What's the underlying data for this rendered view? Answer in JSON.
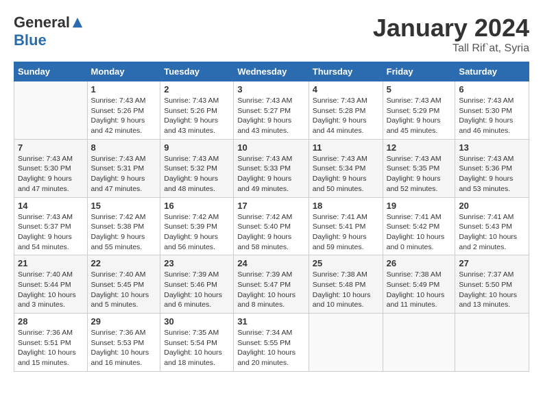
{
  "logo": {
    "general": "General",
    "blue": "Blue"
  },
  "title": "January 2024",
  "subtitle": "Tall Rif`at, Syria",
  "headers": [
    "Sunday",
    "Monday",
    "Tuesday",
    "Wednesday",
    "Thursday",
    "Friday",
    "Saturday"
  ],
  "weeks": [
    [
      {
        "day": "",
        "info": ""
      },
      {
        "day": "1",
        "info": "Sunrise: 7:43 AM\nSunset: 5:26 PM\nDaylight: 9 hours\nand 42 minutes."
      },
      {
        "day": "2",
        "info": "Sunrise: 7:43 AM\nSunset: 5:26 PM\nDaylight: 9 hours\nand 43 minutes."
      },
      {
        "day": "3",
        "info": "Sunrise: 7:43 AM\nSunset: 5:27 PM\nDaylight: 9 hours\nand 43 minutes."
      },
      {
        "day": "4",
        "info": "Sunrise: 7:43 AM\nSunset: 5:28 PM\nDaylight: 9 hours\nand 44 minutes."
      },
      {
        "day": "5",
        "info": "Sunrise: 7:43 AM\nSunset: 5:29 PM\nDaylight: 9 hours\nand 45 minutes."
      },
      {
        "day": "6",
        "info": "Sunrise: 7:43 AM\nSunset: 5:30 PM\nDaylight: 9 hours\nand 46 minutes."
      }
    ],
    [
      {
        "day": "7",
        "info": "Sunrise: 7:43 AM\nSunset: 5:30 PM\nDaylight: 9 hours\nand 47 minutes."
      },
      {
        "day": "8",
        "info": "Sunrise: 7:43 AM\nSunset: 5:31 PM\nDaylight: 9 hours\nand 47 minutes."
      },
      {
        "day": "9",
        "info": "Sunrise: 7:43 AM\nSunset: 5:32 PM\nDaylight: 9 hours\nand 48 minutes."
      },
      {
        "day": "10",
        "info": "Sunrise: 7:43 AM\nSunset: 5:33 PM\nDaylight: 9 hours\nand 49 minutes."
      },
      {
        "day": "11",
        "info": "Sunrise: 7:43 AM\nSunset: 5:34 PM\nDaylight: 9 hours\nand 50 minutes."
      },
      {
        "day": "12",
        "info": "Sunrise: 7:43 AM\nSunset: 5:35 PM\nDaylight: 9 hours\nand 52 minutes."
      },
      {
        "day": "13",
        "info": "Sunrise: 7:43 AM\nSunset: 5:36 PM\nDaylight: 9 hours\nand 53 minutes."
      }
    ],
    [
      {
        "day": "14",
        "info": "Sunrise: 7:43 AM\nSunset: 5:37 PM\nDaylight: 9 hours\nand 54 minutes."
      },
      {
        "day": "15",
        "info": "Sunrise: 7:42 AM\nSunset: 5:38 PM\nDaylight: 9 hours\nand 55 minutes."
      },
      {
        "day": "16",
        "info": "Sunrise: 7:42 AM\nSunset: 5:39 PM\nDaylight: 9 hours\nand 56 minutes."
      },
      {
        "day": "17",
        "info": "Sunrise: 7:42 AM\nSunset: 5:40 PM\nDaylight: 9 hours\nand 58 minutes."
      },
      {
        "day": "18",
        "info": "Sunrise: 7:41 AM\nSunset: 5:41 PM\nDaylight: 9 hours\nand 59 minutes."
      },
      {
        "day": "19",
        "info": "Sunrise: 7:41 AM\nSunset: 5:42 PM\nDaylight: 10 hours\nand 0 minutes."
      },
      {
        "day": "20",
        "info": "Sunrise: 7:41 AM\nSunset: 5:43 PM\nDaylight: 10 hours\nand 2 minutes."
      }
    ],
    [
      {
        "day": "21",
        "info": "Sunrise: 7:40 AM\nSunset: 5:44 PM\nDaylight: 10 hours\nand 3 minutes."
      },
      {
        "day": "22",
        "info": "Sunrise: 7:40 AM\nSunset: 5:45 PM\nDaylight: 10 hours\nand 5 minutes."
      },
      {
        "day": "23",
        "info": "Sunrise: 7:39 AM\nSunset: 5:46 PM\nDaylight: 10 hours\nand 6 minutes."
      },
      {
        "day": "24",
        "info": "Sunrise: 7:39 AM\nSunset: 5:47 PM\nDaylight: 10 hours\nand 8 minutes."
      },
      {
        "day": "25",
        "info": "Sunrise: 7:38 AM\nSunset: 5:48 PM\nDaylight: 10 hours\nand 10 minutes."
      },
      {
        "day": "26",
        "info": "Sunrise: 7:38 AM\nSunset: 5:49 PM\nDaylight: 10 hours\nand 11 minutes."
      },
      {
        "day": "27",
        "info": "Sunrise: 7:37 AM\nSunset: 5:50 PM\nDaylight: 10 hours\nand 13 minutes."
      }
    ],
    [
      {
        "day": "28",
        "info": "Sunrise: 7:36 AM\nSunset: 5:51 PM\nDaylight: 10 hours\nand 15 minutes."
      },
      {
        "day": "29",
        "info": "Sunrise: 7:36 AM\nSunset: 5:53 PM\nDaylight: 10 hours\nand 16 minutes."
      },
      {
        "day": "30",
        "info": "Sunrise: 7:35 AM\nSunset: 5:54 PM\nDaylight: 10 hours\nand 18 minutes."
      },
      {
        "day": "31",
        "info": "Sunrise: 7:34 AM\nSunset: 5:55 PM\nDaylight: 10 hours\nand 20 minutes."
      },
      {
        "day": "",
        "info": ""
      },
      {
        "day": "",
        "info": ""
      },
      {
        "day": "",
        "info": ""
      }
    ]
  ]
}
